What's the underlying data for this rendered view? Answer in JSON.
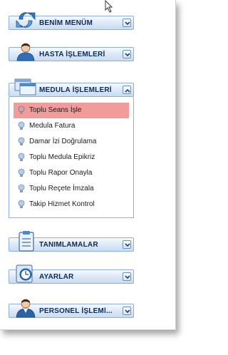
{
  "sidebar": {
    "sections": [
      {
        "title": "BENİM MENÜM",
        "icon": "refresh-arrows-icon",
        "state": "collapsed"
      },
      {
        "title": "HASTA İŞLEMLERİ",
        "icon": "person-icon",
        "state": "collapsed"
      },
      {
        "title": "MEDULA İŞLEMLERİ",
        "icon": "windows-icon",
        "state": "expanded"
      },
      {
        "title": "TANIMLAMALAR",
        "icon": "clipboard-icon",
        "state": "collapsed"
      },
      {
        "title": "AYARLAR",
        "icon": "clock-icon",
        "state": "collapsed"
      },
      {
        "title": "PERSONEL İŞLEMl...",
        "icon": "staff-icon",
        "state": "collapsed"
      }
    ],
    "medula_items": [
      {
        "label": "Toplu Seans İşle",
        "active": true
      },
      {
        "label": "Medula Fatura",
        "active": false
      },
      {
        "label": "Damar İzi Doğrulama",
        "active": false
      },
      {
        "label": "Toplu Medula Epikriz",
        "active": false
      },
      {
        "label": "Toplu Rapor Onayla",
        "active": false
      },
      {
        "label": "Toplu Reçete İmzala",
        "active": false
      },
      {
        "label": "Takip Hizmet Kontrol",
        "active": false
      }
    ]
  },
  "colors": {
    "active_item": "#f29b9b",
    "header_border": "#8eb0d8",
    "title_text": "#0e2a57"
  }
}
